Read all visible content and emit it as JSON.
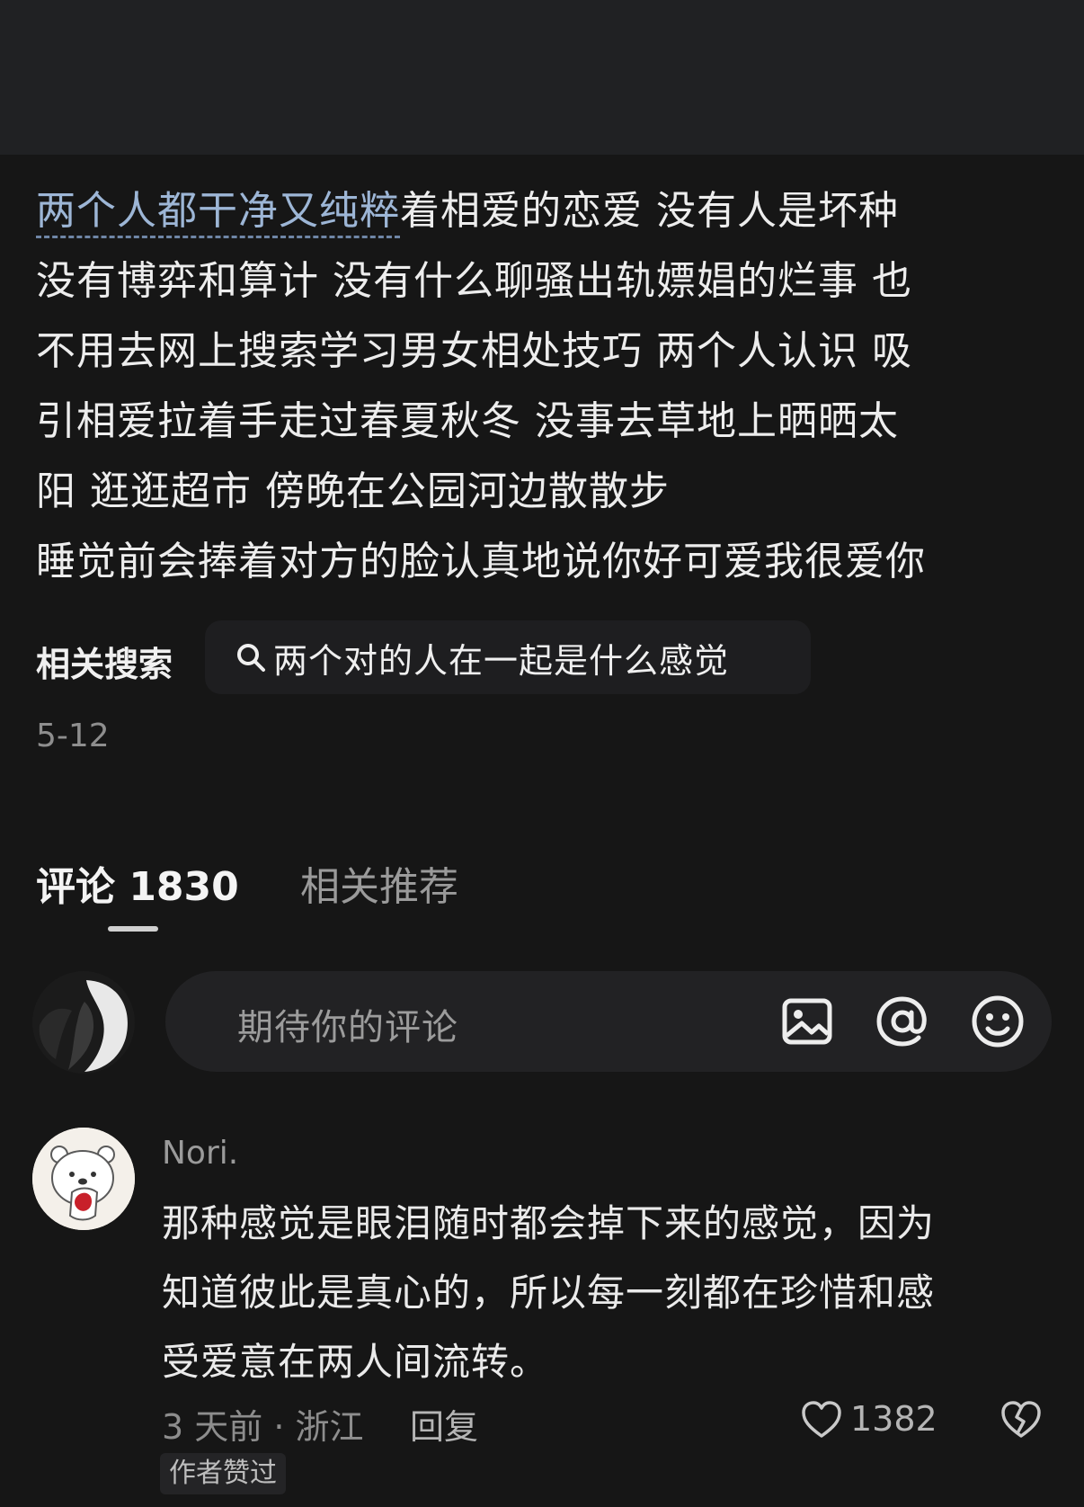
{
  "post": {
    "highlight": "两个人都干净又纯粹",
    "line1_rest": "着相爱的恋爱 没有人是坏种",
    "line2": "没有博弈和算计 没有什么聊骚出轨嫖娼的烂事 也",
    "line3": "不用去网上搜索学习男女相处技巧 两个人认识 吸",
    "line4": "引相爱拉着手走过春夏秋冬 没事去草地上晒晒太",
    "line5": "阳 逛逛超市 傍晚在公园河边散散步",
    "line6": "睡觉前会捧着对方的脸认真地说你好可爱我很爱你",
    "date": "5-12"
  },
  "related_search": {
    "label": "相关搜索",
    "query": "两个对的人在一起是什么感觉"
  },
  "tabs": {
    "comments": "评论 1830",
    "related": "相关推荐"
  },
  "comment_input": {
    "placeholder": "期待你的评论",
    "icons": [
      "image-icon",
      "at-icon",
      "emoji-icon"
    ]
  },
  "comment": {
    "user": "Nori.",
    "line1": "那种感觉是眼泪随时都会掉下来的感觉，因为",
    "line2": "知道彼此是真心的，所以每一刻都在珍惜和感",
    "line3": "受爱意在两人间流转。",
    "time_location": "3 天前 · 浙江",
    "reply": "回复",
    "likes": "1382",
    "author_badge": "作者赞过"
  },
  "colors": {
    "background": "#161616",
    "top_band": "#202123",
    "highlight_text": "#9db6d6"
  }
}
